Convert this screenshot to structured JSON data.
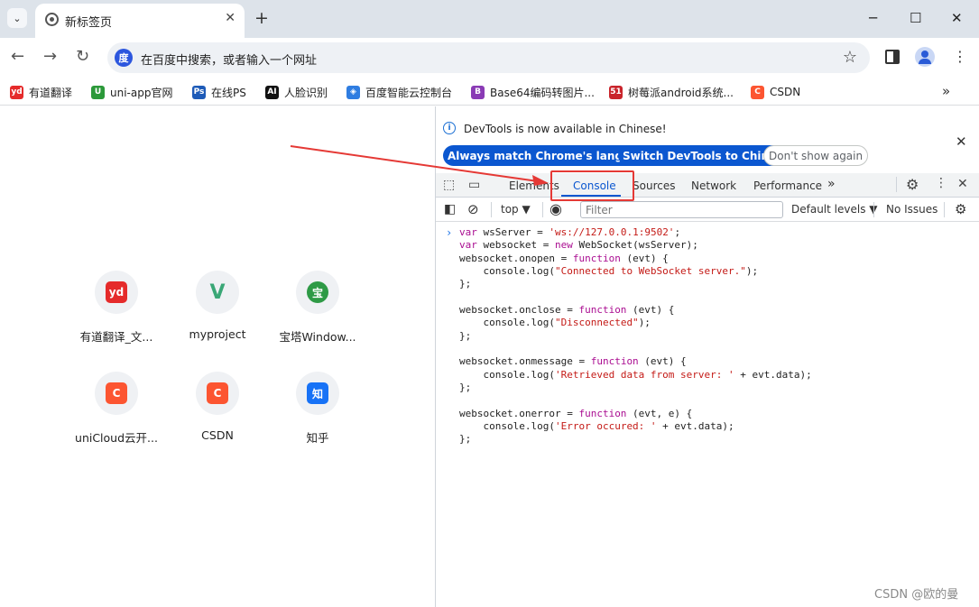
{
  "browser": {
    "tab": {
      "title": "新标签页"
    },
    "new_tab_symbol": "+",
    "window_controls": {
      "minimize": "─",
      "maximize": "☐",
      "close": "✕"
    }
  },
  "toolbar": {
    "back": "←",
    "forward": "→",
    "reload": "↻",
    "omnibox_text": "在百度中搜索，或者输入一个网址",
    "star": "☆",
    "menu": "⋮"
  },
  "bookmarks": [
    {
      "label": "有道翻译",
      "icon": "youdao-icon",
      "icon_text": "yd",
      "color": "#e52b2b"
    },
    {
      "label": "uni-app官网",
      "icon": "uniapp-icon",
      "icon_text": "U",
      "color": "#2b9939"
    },
    {
      "label": "在线PS",
      "icon": "ps-icon",
      "icon_text": "Ps",
      "color": "#1e5bb8"
    },
    {
      "label": "人脸识别",
      "icon": "ai-icon",
      "icon_text": "AI",
      "color": "#111111"
    },
    {
      "label": "百度智能云控制台",
      "icon": "baidu-cloud-icon",
      "icon_text": "◈",
      "color": "#2f7de1"
    },
    {
      "label": "Base64编码转图片...",
      "icon": "base64-icon",
      "icon_text": "B",
      "color": "#8a3bb5"
    },
    {
      "label": "树莓派android系统...",
      "icon": "51-icon",
      "icon_text": "51",
      "color": "#c9242b"
    },
    {
      "label": "CSDN",
      "icon": "csdn-icon",
      "icon_text": "C",
      "color": "#fc5531"
    }
  ],
  "bookmarks_more": "»",
  "shortcuts": [
    {
      "label": "有道翻译_文...",
      "icon": "youdao-icon",
      "icon_text": "yd",
      "color": "#e52b2b"
    },
    {
      "label": "myproject",
      "icon": "vue-icon",
      "icon_text": "V",
      "color": "#3aa776"
    },
    {
      "label": "宝塔Window...",
      "icon": "baota-icon",
      "icon_text": "宝",
      "color": "#2e9a46"
    },
    {
      "label": "uniCloud云开...",
      "icon": "csdn-icon",
      "icon_text": "C",
      "color": "#fc5531"
    },
    {
      "label": "CSDN",
      "icon": "csdn-icon",
      "icon_text": "C",
      "color": "#fc5531"
    },
    {
      "label": "知乎",
      "icon": "zhihu-icon",
      "icon_text": "知",
      "color": "#1772f6"
    }
  ],
  "devtools": {
    "infobar": {
      "message": "DevTools is now available in Chinese!",
      "btn_match": "Always match Chrome's language",
      "btn_switch": "Switch DevTools to Chinese",
      "btn_dismiss": "Don't show again",
      "close": "✕"
    },
    "tabs": [
      "Elements",
      "Console",
      "Sources",
      "Network",
      "Performance"
    ],
    "active_tab": "Console",
    "tabs_more": "»",
    "console_bar": {
      "context": "top ▼",
      "filter_placeholder": "Filter",
      "levels": "Default levels ▼",
      "issues": "No Issues"
    },
    "prompt": "›",
    "watermark": "CSDN @欧的曼"
  },
  "console_code": [
    "var wsServer = 'ws://127.0.0.1:9502';",
    "var websocket = new WebSocket(wsServer);",
    "websocket.onopen = function (evt) {",
    "    console.log(\"Connected to WebSocket server.\");",
    "};",
    "",
    "websocket.onclose = function (evt) {",
    "    console.log(\"Disconnected\");",
    "};",
    "",
    "websocket.onmessage = function (evt) {",
    "    console.log('Retrieved data from server: ' + evt.data);",
    "};",
    "",
    "websocket.onerror = function (evt, e) {",
    "    console.log('Error occured: ' + evt.data);",
    "};"
  ]
}
